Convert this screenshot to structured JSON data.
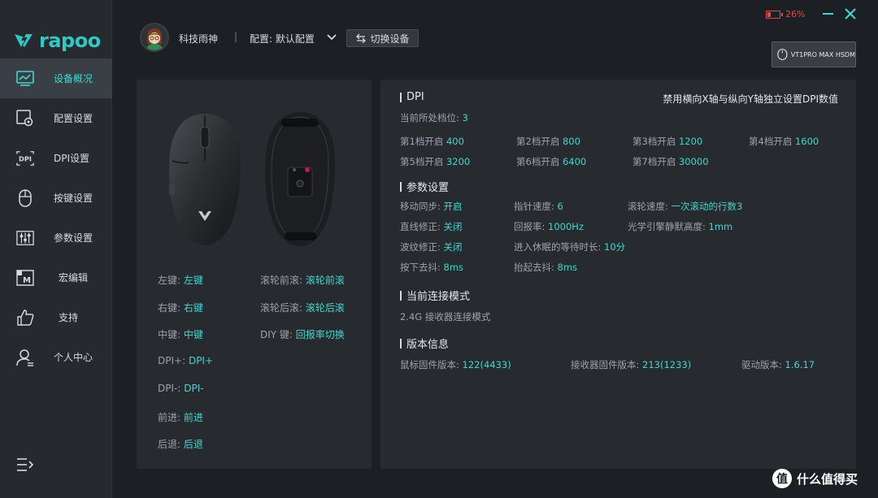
{
  "brand": {
    "logo_text": "rapoo",
    "accent": "#3ed8cf"
  },
  "sidebar": {
    "items": [
      {
        "label": "设备概况",
        "icon": "monitor-chart-icon",
        "active": true
      },
      {
        "label": "配置设置",
        "icon": "config-gear-icon"
      },
      {
        "label": "DPI设置",
        "icon": "dpi-icon"
      },
      {
        "label": "按键设置",
        "icon": "mouse-icon"
      },
      {
        "label": "参数设置",
        "icon": "sliders-icon"
      },
      {
        "label": "宏编辑",
        "icon": "macro-icon"
      },
      {
        "label": "支持",
        "icon": "thumbs-up-icon"
      },
      {
        "label": "个人中心",
        "icon": "user-icon"
      }
    ],
    "menu_icon": "menu-icon"
  },
  "header": {
    "username": "科技雨神",
    "separator": "|",
    "config_label": "配置: 默认配置",
    "switch_button": "切换设备",
    "battery_percent": "26%",
    "battery_level": 0.26,
    "device_name": "VT1PRO MAX HSDM"
  },
  "left": {
    "rows": [
      {
        "k": "左键:",
        "v": "左键"
      },
      {
        "k": "右键:",
        "v": "右键"
      },
      {
        "k": "中键:",
        "v": "中键"
      },
      {
        "k": "DPI+:",
        "v": "DPI+"
      },
      {
        "k": "DPI-:",
        "v": "DPI-"
      },
      {
        "k": "前进:",
        "v": "前进"
      },
      {
        "k": "后退:",
        "v": "后退"
      }
    ],
    "rows2": [
      {
        "k": "滚轮前滚:",
        "v": "滚轮前滚"
      },
      {
        "k": "滚轮后滚:",
        "v": "滚轮后滚"
      },
      {
        "k": "DIY 键:",
        "v": "回报率切换"
      }
    ]
  },
  "dpi": {
    "title": "DPI",
    "note": "禁用横向X轴与纵向Y轴独立设置DPI数值",
    "current_label": "当前所处档位:",
    "current_value": "3",
    "levels": [
      {
        "k": "第1档开启",
        "v": "400"
      },
      {
        "k": "第2档开启",
        "v": "800"
      },
      {
        "k": "第3档开启",
        "v": "1200"
      },
      {
        "k": "第4档开启",
        "v": "1600"
      },
      {
        "k": "第5档开启",
        "v": "3200"
      },
      {
        "k": "第6档开启",
        "v": "6400"
      },
      {
        "k": "第7档开启",
        "v": "30000"
      }
    ]
  },
  "params": {
    "title": "参数设置",
    "items": [
      {
        "k": "移动同步:",
        "v": "开启"
      },
      {
        "k": "指针速度:",
        "v": "6"
      },
      {
        "k": "滚轮速度:",
        "v": "一次滚动的行数3"
      },
      {
        "k": "直线修正:",
        "v": "关闭"
      },
      {
        "k": "回报率:",
        "v": "1000Hz"
      },
      {
        "k": "光学引擎静默高度:",
        "v": "1mm"
      },
      {
        "k": "波纹修正:",
        "v": "关闭"
      },
      {
        "k": "进入休眠的等待时长:",
        "v": "10分"
      },
      {
        "k": "按下去抖:",
        "v": "8ms"
      },
      {
        "k": "抬起去抖:",
        "v": "8ms"
      }
    ]
  },
  "connection": {
    "title": "当前连接模式",
    "value": "2.4G 接收器连接模式"
  },
  "version": {
    "title": "版本信息",
    "items": [
      {
        "k": "鼠标固件版本:",
        "v": "122(4433)"
      },
      {
        "k": "接收器固件版本:",
        "v": "213(1233)"
      },
      {
        "k": "驱动版本:",
        "v": "1.6.17"
      }
    ]
  },
  "watermark": {
    "icon": "值",
    "text": "什么值得买"
  }
}
